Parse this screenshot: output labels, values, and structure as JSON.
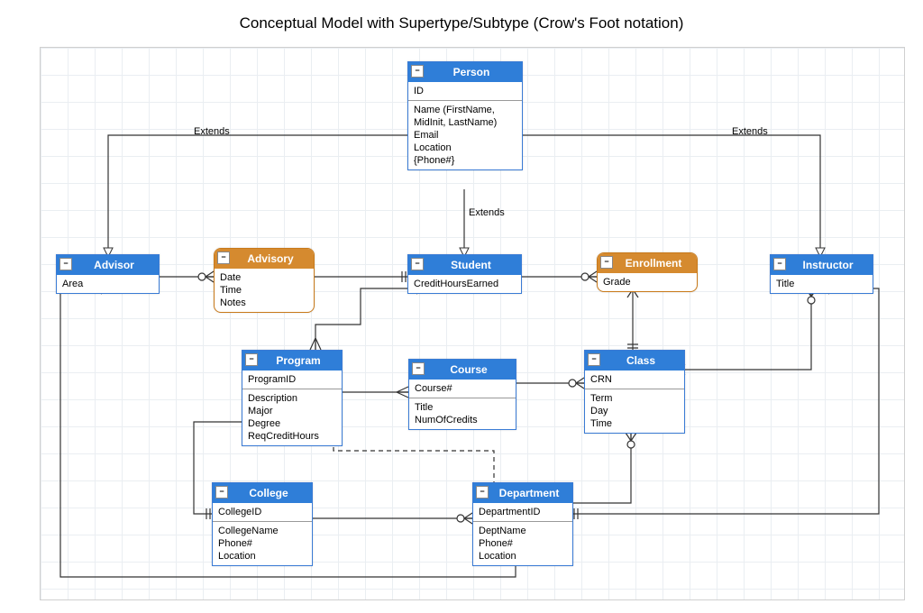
{
  "title": "Conceptual Model with Supertype/Subtype (Crow's Foot notation)",
  "labels": {
    "extendsLeft": "Extends",
    "extendsMid": "Extends",
    "extendsRight": "Extends"
  },
  "entities": {
    "person": {
      "name": "Person",
      "pk": "ID",
      "attrs": "Name (FirstName,\n   MidInit, LastName)\nEmail\nLocation\n{Phone#}"
    },
    "advisor": {
      "name": "Advisor",
      "attrs": "Area"
    },
    "advisory": {
      "name": "Advisory",
      "attrs": "Date\nTime\nNotes"
    },
    "student": {
      "name": "Student",
      "attrs": "CreditHoursEarned"
    },
    "enrollment": {
      "name": "Enrollment",
      "attrs": "Grade"
    },
    "instructor": {
      "name": "Instructor",
      "attrs": "Title"
    },
    "program": {
      "name": "Program",
      "pk": "ProgramID",
      "attrs": "Description\nMajor\nDegree\nReqCreditHours"
    },
    "course": {
      "name": "Course",
      "pk": "Course#",
      "attrs": "Title\nNumOfCredits"
    },
    "class": {
      "name": "Class",
      "pk": "CRN",
      "attrs": "Term\nDay\nTime"
    },
    "college": {
      "name": "College",
      "pk": "CollegeID",
      "attrs": "CollegeName\nPhone#\nLocation"
    },
    "department": {
      "name": "Department",
      "pk": "DepartmentID",
      "attrs": "DeptName\nPhone#\nLocation"
    }
  }
}
